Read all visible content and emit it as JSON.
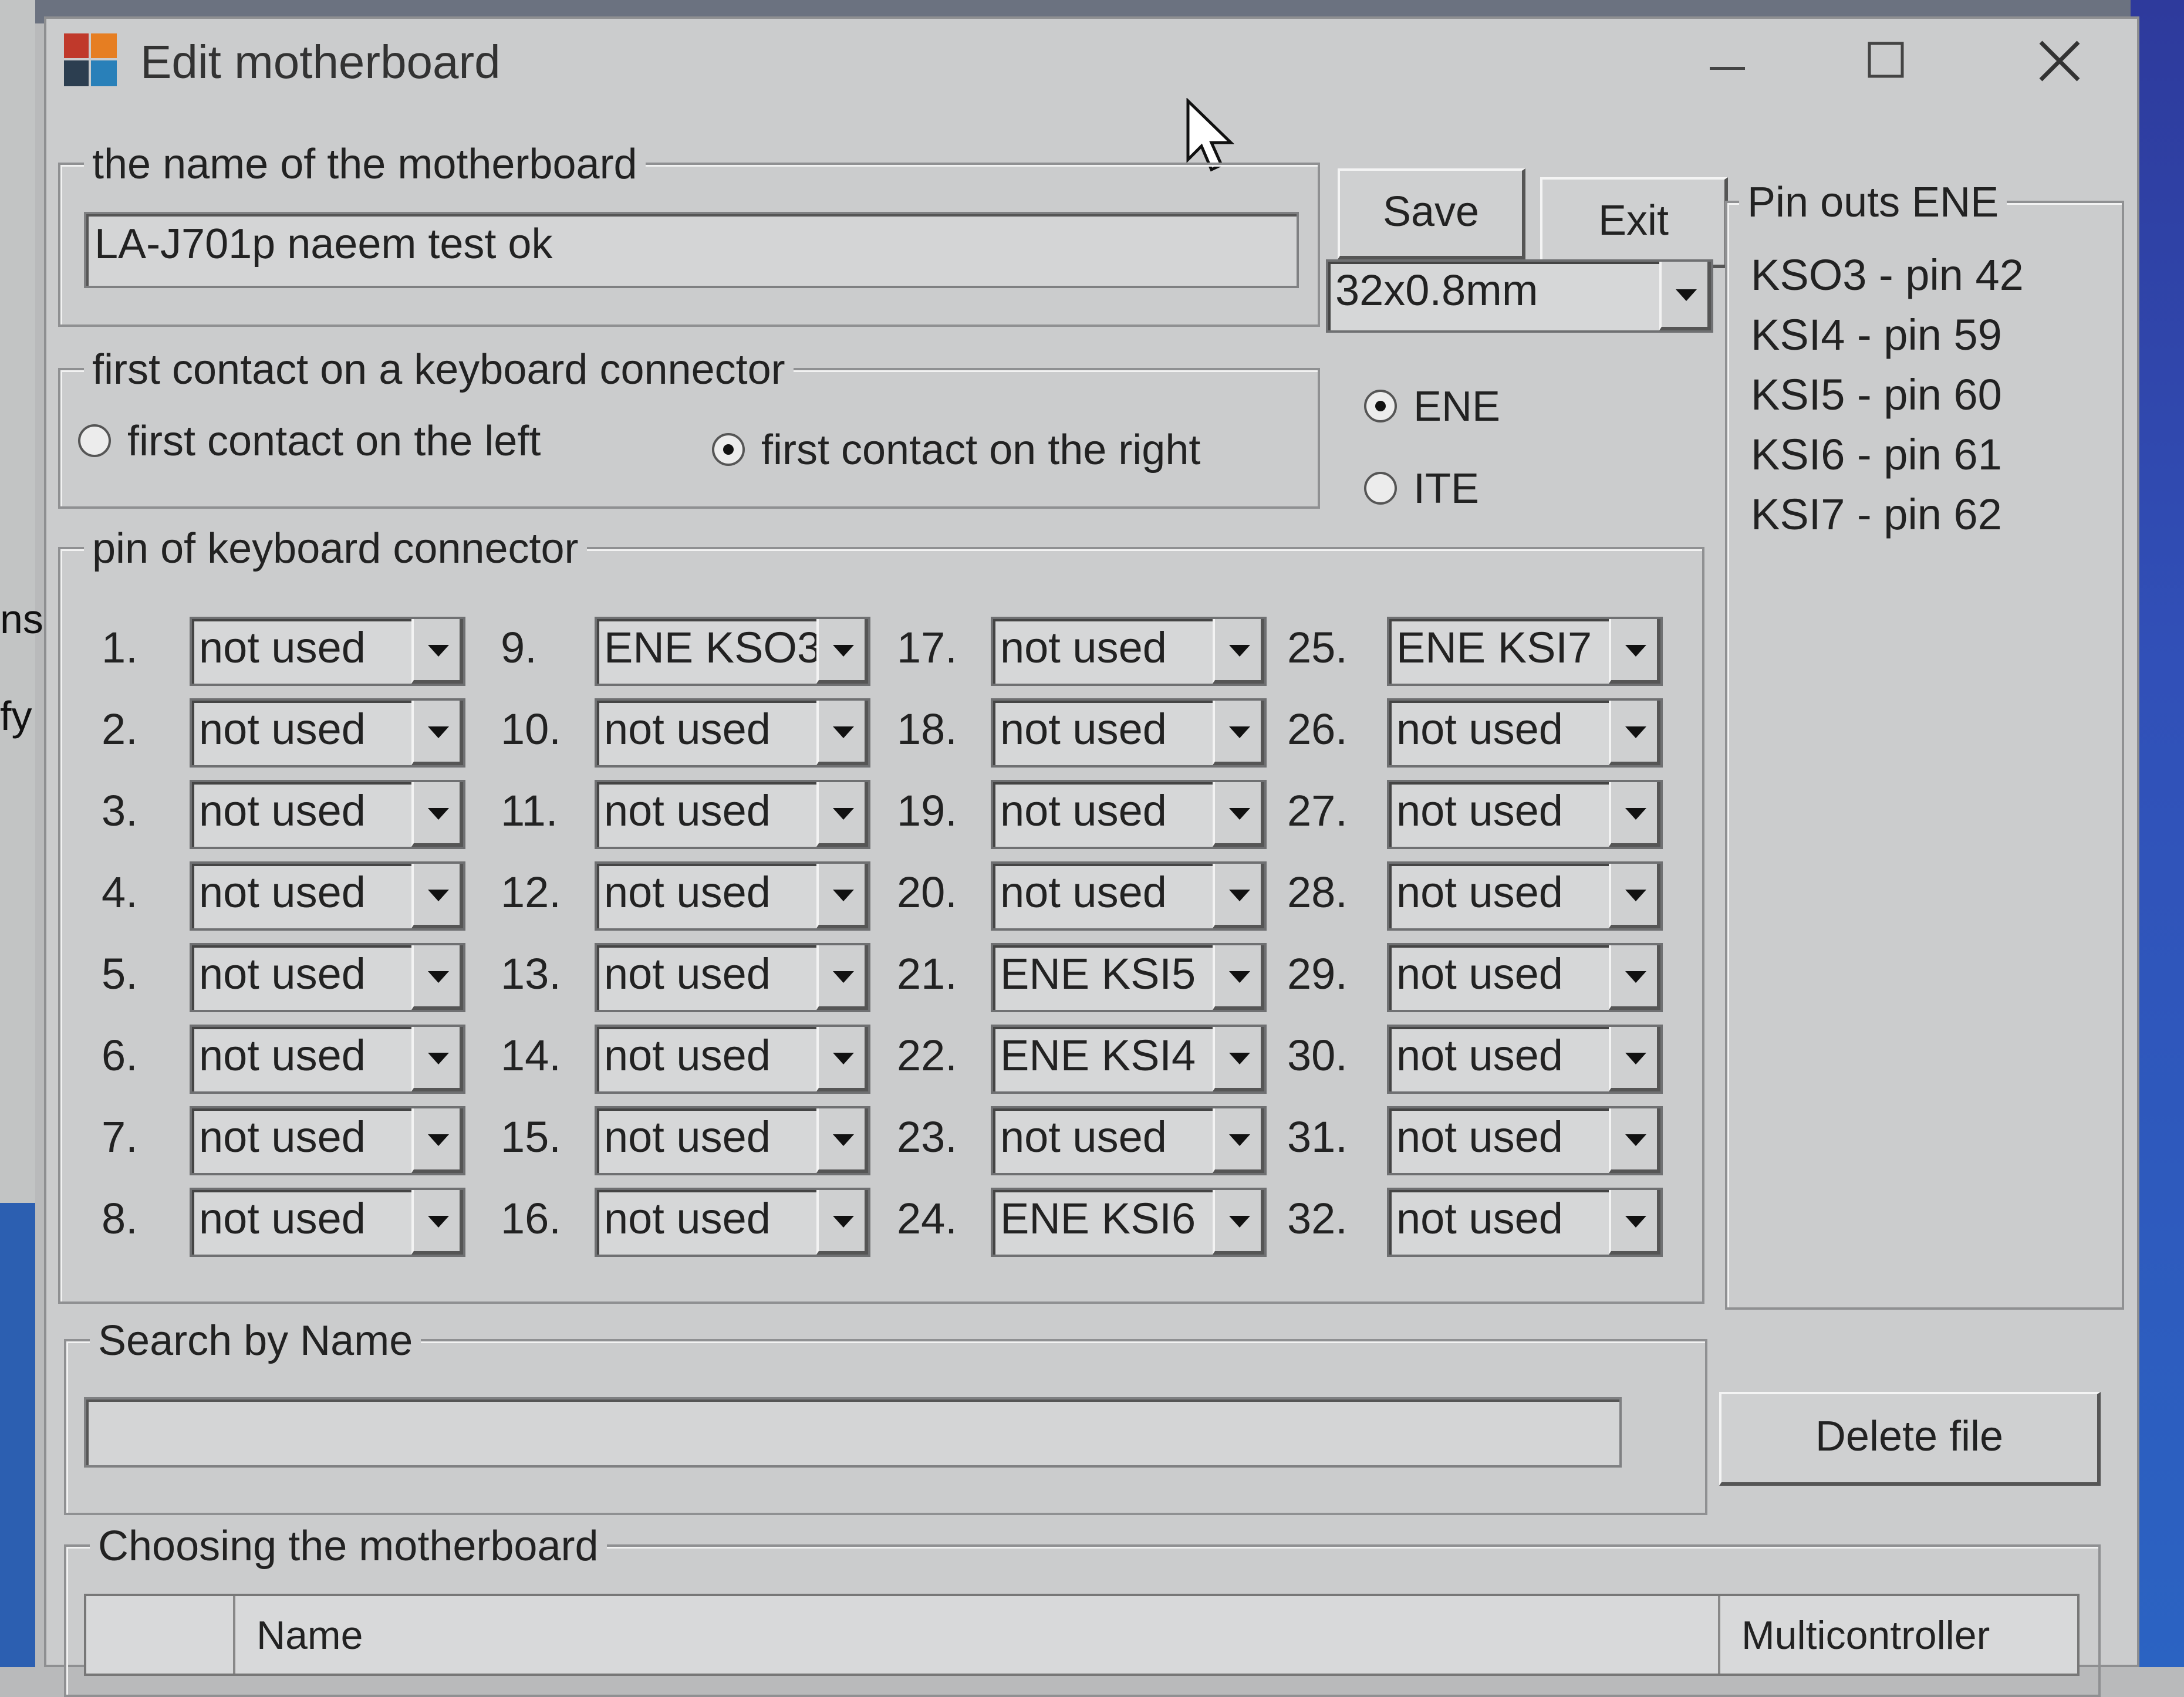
{
  "window": {
    "title": "Edit motherboard"
  },
  "background": {
    "left_text_1": "ns",
    "left_text_2": "fy"
  },
  "motherboard_name": {
    "legend": "the name of the motherboard",
    "value": "LA-J701p naeem test ok"
  },
  "buttons": {
    "save": "Save",
    "exit": "Exit",
    "delete": "Delete file"
  },
  "connector_type": {
    "selected": "32x0.8mm"
  },
  "first_contact": {
    "legend": "first contact on a keyboard connector",
    "left_label": "first contact on the left",
    "right_label": "first contact on the right",
    "selected": "right"
  },
  "controller": {
    "ene_label": "ENE",
    "ite_label": "ITE",
    "selected": "ENE"
  },
  "pinouts": {
    "legend": "Pin outs ENE",
    "lines": [
      "KSO3 - pin 42",
      "KSI4  - pin 59",
      "KSI5  - pin 60",
      "KSI6  - pin 61",
      "KSI7  - pin 62"
    ]
  },
  "pins": {
    "legend": "pin of keyboard connector",
    "items": [
      {
        "num": "1.",
        "value": "not used"
      },
      {
        "num": "2.",
        "value": "not used"
      },
      {
        "num": "3.",
        "value": "not used"
      },
      {
        "num": "4.",
        "value": "not used"
      },
      {
        "num": "5.",
        "value": "not used"
      },
      {
        "num": "6.",
        "value": "not used"
      },
      {
        "num": "7.",
        "value": "not used"
      },
      {
        "num": "8.",
        "value": "not used"
      },
      {
        "num": "9.",
        "value": "ENE KSO3"
      },
      {
        "num": "10.",
        "value": "not used"
      },
      {
        "num": "11.",
        "value": "not used"
      },
      {
        "num": "12.",
        "value": "not used"
      },
      {
        "num": "13.",
        "value": "not used"
      },
      {
        "num": "14.",
        "value": "not used"
      },
      {
        "num": "15.",
        "value": "not used"
      },
      {
        "num": "16.",
        "value": "not used"
      },
      {
        "num": "17.",
        "value": "not used"
      },
      {
        "num": "18.",
        "value": "not used"
      },
      {
        "num": "19.",
        "value": "not used"
      },
      {
        "num": "20.",
        "value": "not used"
      },
      {
        "num": "21.",
        "value": "ENE KSI5"
      },
      {
        "num": "22.",
        "value": "ENE KSI4"
      },
      {
        "num": "23.",
        "value": "not used"
      },
      {
        "num": "24.",
        "value": "ENE KSI6"
      },
      {
        "num": "25.",
        "value": "ENE KSI7"
      },
      {
        "num": "26.",
        "value": "not used"
      },
      {
        "num": "27.",
        "value": "not used"
      },
      {
        "num": "28.",
        "value": "not used"
      },
      {
        "num": "29.",
        "value": "not used"
      },
      {
        "num": "30.",
        "value": "not used"
      },
      {
        "num": "31.",
        "value": "not used"
      },
      {
        "num": "32.",
        "value": "not used"
      }
    ]
  },
  "search": {
    "legend": "Search by Name",
    "value": ""
  },
  "choosing": {
    "legend": "Choosing the motherboard",
    "col_name": "Name",
    "col_multicontroller": "Multicontroller"
  }
}
